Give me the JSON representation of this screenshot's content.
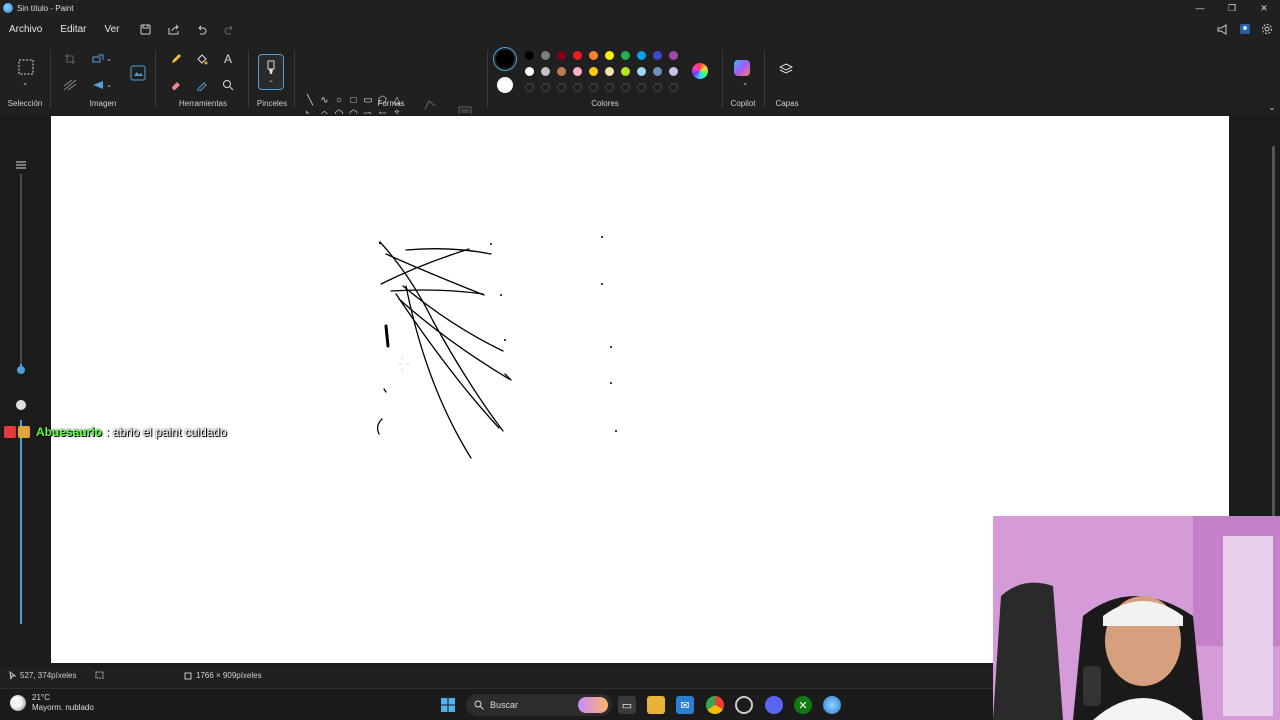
{
  "window": {
    "title": "Sin título - Paint",
    "controls": {
      "minimize": "—",
      "maximize": "❐",
      "close": "✕"
    }
  },
  "menu": {
    "items": [
      "Archivo",
      "Editar",
      "Ver"
    ]
  },
  "ribbon": {
    "groups": {
      "selection": "Selección",
      "image": "Imagen",
      "tools": "Herramientas",
      "brushes": "Pinceles",
      "shapes": "Formas",
      "colors": "Colores",
      "copilot": "Copilot",
      "layers": "Capas"
    },
    "palette_row1": [
      "#000000",
      "#7f7f7f",
      "#880015",
      "#ed1c24",
      "#ff7f27",
      "#fff200",
      "#22b14c",
      "#00a2e8",
      "#3f48cc",
      "#a349a4"
    ],
    "palette_row2": [
      "#ffffff",
      "#c3c3c3",
      "#b97a57",
      "#ffaec9",
      "#ffc90e",
      "#efe4b0",
      "#b5e61d",
      "#99d9ea",
      "#7092be",
      "#c8bfe7"
    ],
    "primary_color": "#000000",
    "secondary_color": "#ffffff",
    "accent": "#4fa0d8"
  },
  "chat": {
    "user": "Abuesaurio",
    "message": ": abrio el paint cuidado",
    "user_color": "#5cff3b"
  },
  "status": {
    "cursor": "527, 374píxeles",
    "canvas_size": "1766 × 909píxeles"
  },
  "taskbar": {
    "weather_temp": "21°C",
    "weather_desc": "Mayorm. nublado",
    "search_placeholder": "Buscar"
  }
}
